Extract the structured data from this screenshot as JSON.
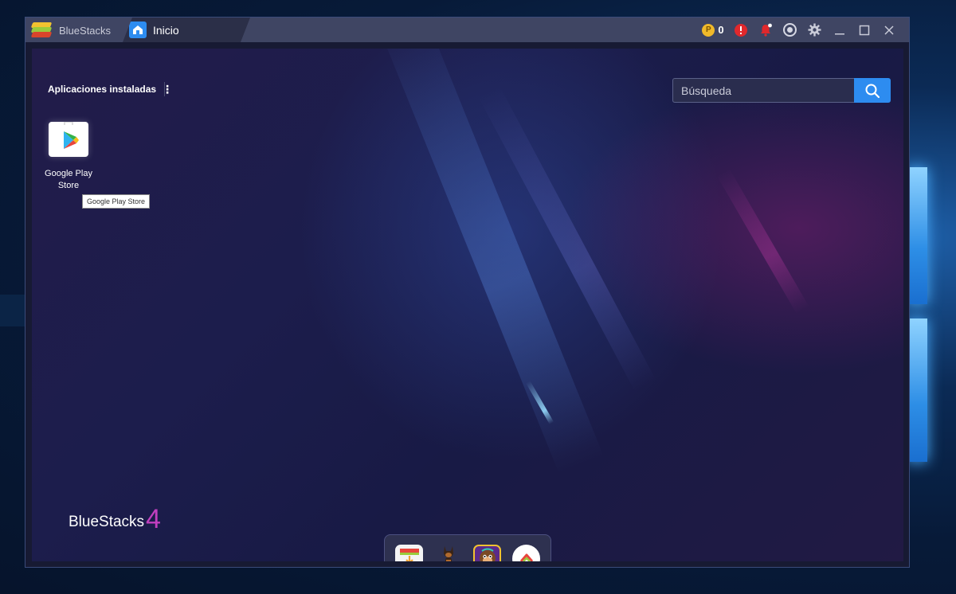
{
  "window": {
    "brand_name": "BlueStacks",
    "active_tab": "Inicio"
  },
  "titlebar": {
    "coins": "0",
    "icons": [
      "coin-icon",
      "alert-icon",
      "notification-bell-icon",
      "profile-icon",
      "settings-gear-icon",
      "minimize-icon",
      "maximize-icon",
      "close-icon"
    ]
  },
  "home": {
    "section_title": "Aplicaciones instaladas",
    "more_label": "⋮",
    "search": {
      "placeholder": "Búsqueda",
      "value": ""
    },
    "apps": [
      {
        "label": "Google Play Store",
        "icon": "google-play-store-icon"
      }
    ],
    "tooltip": "Google Play Store",
    "watermark": {
      "text": "BlueStacks",
      "version": "4"
    },
    "dock": [
      {
        "icon": "app-center-download-icon"
      },
      {
        "icon": "doberman-game-icon"
      },
      {
        "icon": "monkey-game-icon"
      },
      {
        "icon": "bluestacks-app-icon"
      }
    ]
  },
  "colors": {
    "accent": "#2d8cf0",
    "titlebar": "#3f4563",
    "alert": "#e0282c",
    "coin": "#f0b92a"
  }
}
